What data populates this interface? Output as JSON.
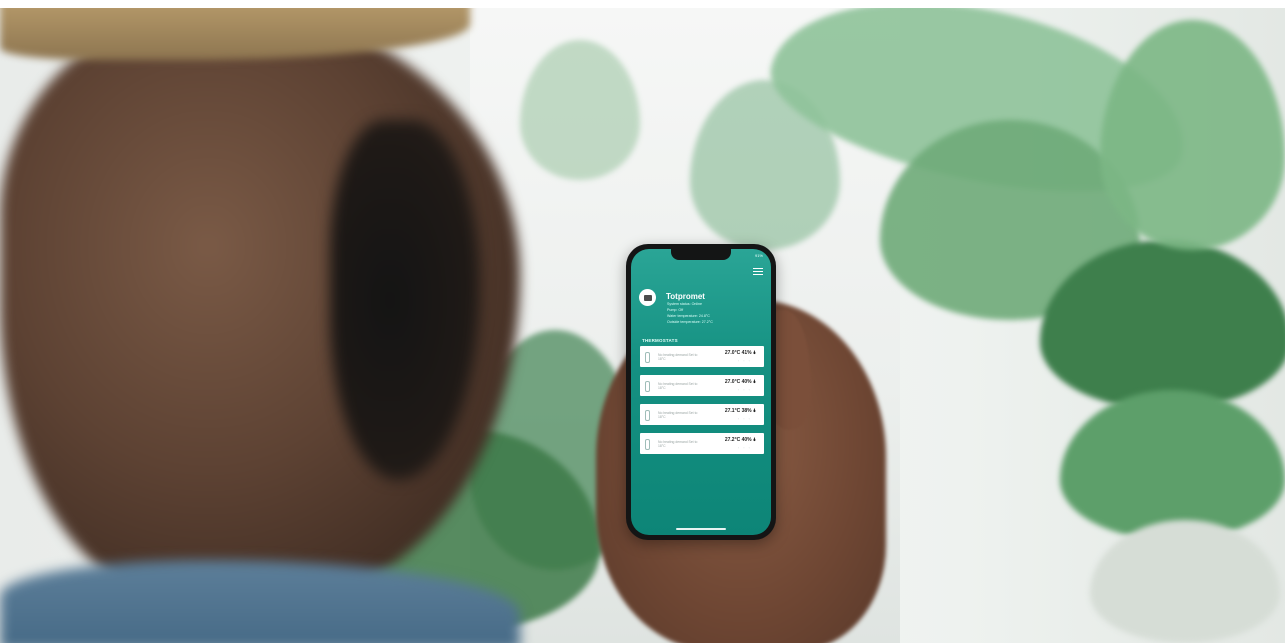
{
  "app": {
    "status_bar": "91%",
    "title": "Totpromet",
    "info_lines": [
      "System status: Online",
      "Pump: Off",
      "Water temperature: 24.8°C",
      "Outside temperature: 27.2°C"
    ],
    "section_title": "THERMOSTATS",
    "thermostats": [
      {
        "name": "No heating demand Set to 18°C",
        "temperature": "27.0°C",
        "humidity": "41%"
      },
      {
        "name": "No heating demand Set to 18°C",
        "temperature": "27.0°C",
        "humidity": "40%"
      },
      {
        "name": "No heating demand Set to 18°C",
        "temperature": "27.1°C",
        "humidity": "38%"
      },
      {
        "name": "No heating demand Set to 18°C",
        "temperature": "27.2°C",
        "humidity": "40%"
      }
    ]
  },
  "colors": {
    "screen_teal": "#159182",
    "card_background": "#ffffff"
  }
}
